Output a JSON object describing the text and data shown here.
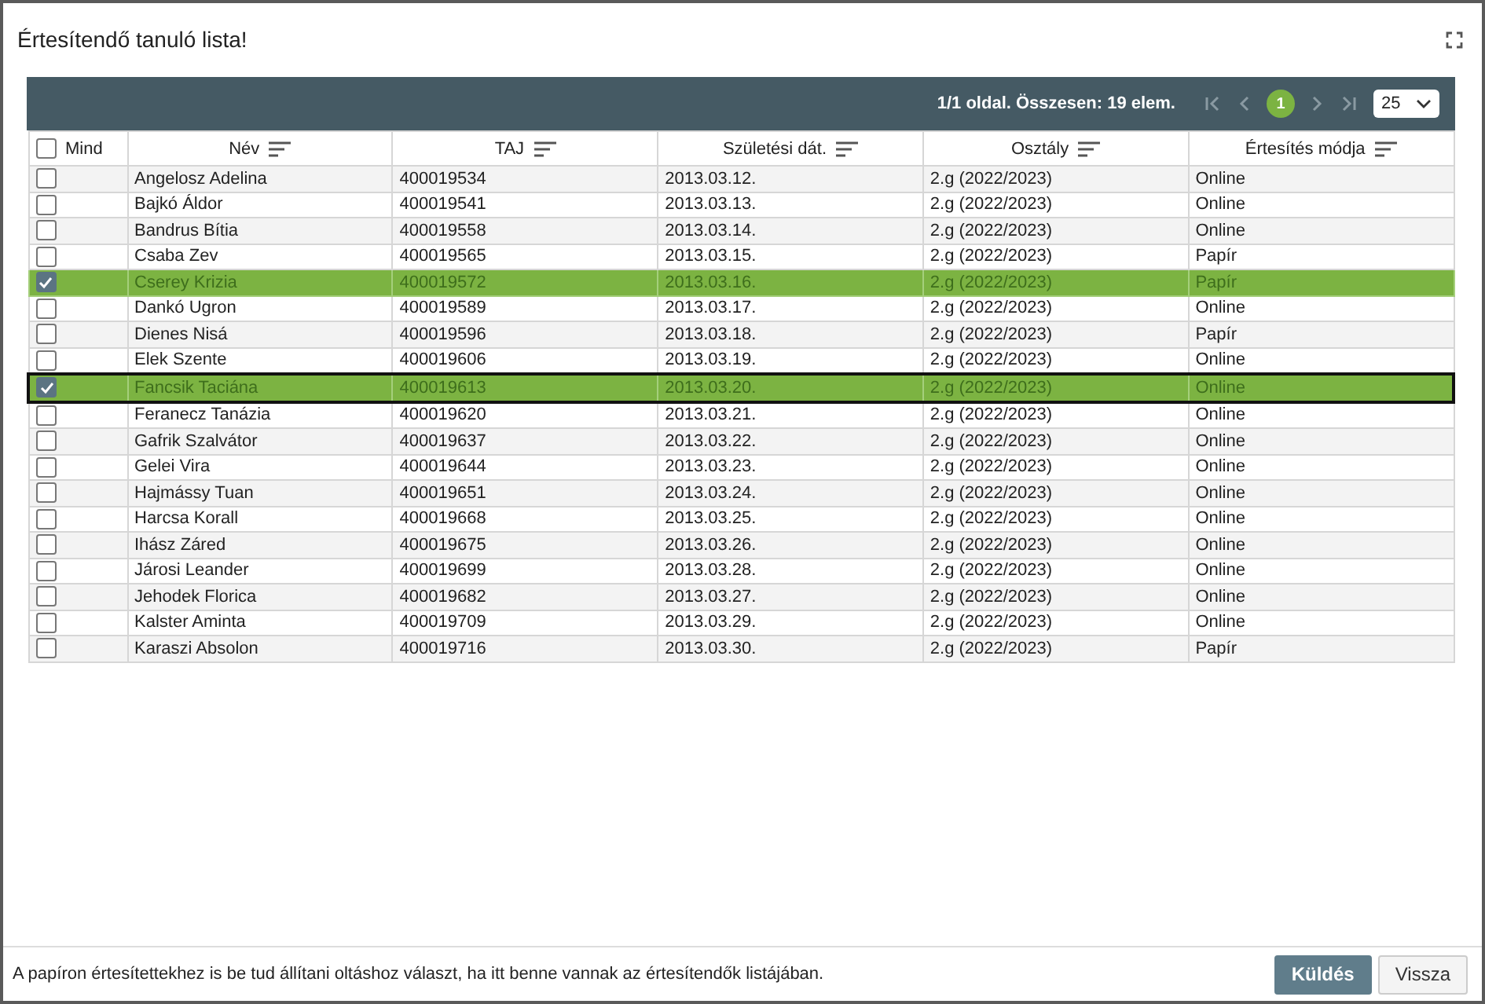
{
  "window": {
    "title": "Értesítendő tanuló lista!"
  },
  "pager": {
    "summary": "1/1 oldal. Összesen: 19 elem.",
    "pages": [
      {
        "label": "1",
        "selected": true
      }
    ],
    "page_size": "25"
  },
  "table": {
    "select_all": {
      "label": "Mind",
      "checked": false
    },
    "columns": [
      "Név",
      "TAJ",
      "Születési dát.",
      "Osztály",
      "Értesítés módja"
    ],
    "rows": [
      {
        "cells": [
          "Angelosz Adelina",
          "400019534",
          "2013.03.12.",
          "2.g (2022/2023)",
          "Online"
        ],
        "selected": false,
        "focused": false
      },
      {
        "cells": [
          "Bajkó Áldor",
          "400019541",
          "2013.03.13.",
          "2.g (2022/2023)",
          "Online"
        ],
        "selected": false,
        "focused": false
      },
      {
        "cells": [
          "Bandrus Bítia",
          "400019558",
          "2013.03.14.",
          "2.g (2022/2023)",
          "Online"
        ],
        "selected": false,
        "focused": false
      },
      {
        "cells": [
          "Csaba Zev",
          "400019565",
          "2013.03.15.",
          "2.g (2022/2023)",
          "Papír"
        ],
        "selected": false,
        "focused": false
      },
      {
        "cells": [
          "Cserey Krizia",
          "400019572",
          "2013.03.16.",
          "2.g (2022/2023)",
          "Papír"
        ],
        "selected": true,
        "focused": false
      },
      {
        "cells": [
          "Dankó Ugron",
          "400019589",
          "2013.03.17.",
          "2.g (2022/2023)",
          "Online"
        ],
        "selected": false,
        "focused": false
      },
      {
        "cells": [
          "Dienes Nisá",
          "400019596",
          "2013.03.18.",
          "2.g (2022/2023)",
          "Papír"
        ],
        "selected": false,
        "focused": false
      },
      {
        "cells": [
          "Elek Szente",
          "400019606",
          "2013.03.19.",
          "2.g (2022/2023)",
          "Online"
        ],
        "selected": false,
        "focused": false
      },
      {
        "cells": [
          "Fancsik Taciána",
          "400019613",
          "2013.03.20.",
          "2.g (2022/2023)",
          "Online"
        ],
        "selected": true,
        "focused": true
      },
      {
        "cells": [
          "Feranecz Tanázia",
          "400019620",
          "2013.03.21.",
          "2.g (2022/2023)",
          "Online"
        ],
        "selected": false,
        "focused": false
      },
      {
        "cells": [
          "Gafrik Szalvátor",
          "400019637",
          "2013.03.22.",
          "2.g (2022/2023)",
          "Online"
        ],
        "selected": false,
        "focused": false
      },
      {
        "cells": [
          "Gelei Vira",
          "400019644",
          "2013.03.23.",
          "2.g (2022/2023)",
          "Online"
        ],
        "selected": false,
        "focused": false
      },
      {
        "cells": [
          "Hajmássy Tuan",
          "400019651",
          "2013.03.24.",
          "2.g (2022/2023)",
          "Online"
        ],
        "selected": false,
        "focused": false
      },
      {
        "cells": [
          "Harcsa Korall",
          "400019668",
          "2013.03.25.",
          "2.g (2022/2023)",
          "Online"
        ],
        "selected": false,
        "focused": false
      },
      {
        "cells": [
          "Ihász Záred",
          "400019675",
          "2013.03.26.",
          "2.g (2022/2023)",
          "Online"
        ],
        "selected": false,
        "focused": false
      },
      {
        "cells": [
          "Járosi Leander",
          "400019699",
          "2013.03.28.",
          "2.g (2022/2023)",
          "Online"
        ],
        "selected": false,
        "focused": false
      },
      {
        "cells": [
          "Jehodek Florica",
          "400019682",
          "2013.03.27.",
          "2.g (2022/2023)",
          "Online"
        ],
        "selected": false,
        "focused": false
      },
      {
        "cells": [
          "Kalster Aminta",
          "400019709",
          "2013.03.29.",
          "2.g (2022/2023)",
          "Online"
        ],
        "selected": false,
        "focused": false
      },
      {
        "cells": [
          "Karaszi Absolon",
          "400019716",
          "2013.03.30.",
          "2.g (2022/2023)",
          "Papír"
        ],
        "selected": false,
        "focused": false
      }
    ]
  },
  "footer": {
    "note": "A papíron értesítettekhez is be tud állítani oltáshoz választ, ha itt benne vannak az értesítendők listájában.",
    "buttons": [
      {
        "label": "Küldés",
        "kind": "primary"
      },
      {
        "label": "Vissza",
        "kind": "secondary"
      }
    ]
  }
}
